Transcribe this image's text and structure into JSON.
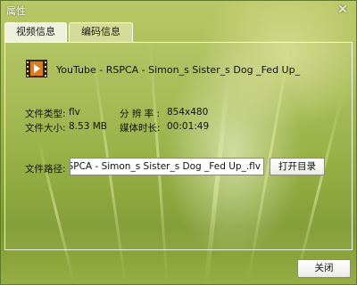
{
  "window": {
    "title": "属性",
    "close_glyph": "✕"
  },
  "tabs": [
    {
      "label": "视频信息",
      "active": true
    },
    {
      "label": "编码信息",
      "active": false
    }
  ],
  "file": {
    "icon": "video-file-icon",
    "name": "YouTube - RSPCA - Simon_s Sister_s Dog _Fed Up_"
  },
  "info": {
    "type_label": "文件类型:",
    "type_value": "flv",
    "size_label": "文件大小:",
    "size_value": "8.53 MB",
    "resolution_label": "分 辨 率 :",
    "resolution_value": "854x480",
    "duration_label": "媒体时长:",
    "duration_value": "00:01:49"
  },
  "path": {
    "label": "文件路径:",
    "value": "ube - RSPCA - Simon_s Sister_s Dog _Fed Up_.flv",
    "open_button": "打开目录"
  },
  "footer": {
    "close_button": "关闭"
  },
  "colors": {
    "background_top": "#b9c867",
    "background_bottom": "#7e9a2f",
    "icon_accent": "#e07a1a"
  }
}
